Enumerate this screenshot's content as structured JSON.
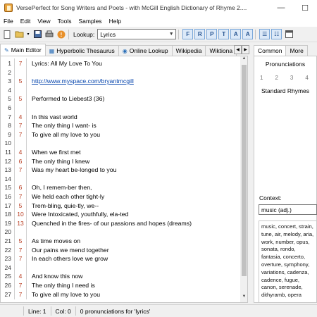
{
  "window": {
    "title": "VersePerfect for Song Writers and Poets - with McGill English Dictionary of Rhyme 2....",
    "minimize": "—",
    "maximize": "☐"
  },
  "menu": [
    "File",
    "Edit",
    "View",
    "Tools",
    "Samples",
    "Help"
  ],
  "toolbar": {
    "lookup_label": "Lookup:",
    "lookup_value": "Lyrics",
    "format_buttons": [
      "F",
      "R",
      "P",
      "T",
      "A",
      "A"
    ]
  },
  "tabs": [
    {
      "label": "Main Editor",
      "icon": "pencil-icon",
      "glyph": "✎"
    },
    {
      "label": "Hyperbolic Thesaurus",
      "icon": "thesaurus-icon",
      "glyph": "▦"
    },
    {
      "label": "Online Lookup",
      "icon": "globe-icon",
      "glyph": "◉"
    },
    {
      "label": "Wikipedia",
      "icon": "",
      "glyph": ""
    },
    {
      "label": "Wiktiona",
      "icon": "",
      "glyph": ""
    }
  ],
  "editor": {
    "lines": [
      {
        "n": "1",
        "s": "7",
        "text": "Lyrics: All My Love To You",
        "link": false
      },
      {
        "n": "2",
        "s": "",
        "text": "",
        "link": false
      },
      {
        "n": "3",
        "s": "5",
        "text": "http://www.myspace.com/bryantmcgill",
        "link": true
      },
      {
        "n": "4",
        "s": "",
        "text": "",
        "link": false
      },
      {
        "n": "5",
        "s": "5",
        "text": "Performed to Liebest3 (36)",
        "link": false
      },
      {
        "n": "6",
        "s": "",
        "text": "",
        "link": false
      },
      {
        "n": "7",
        "s": "4",
        "text": "In this vast world",
        "link": false
      },
      {
        "n": "8",
        "s": "7",
        "text": "The only thing I want- is",
        "link": false
      },
      {
        "n": "9",
        "s": "7",
        "text": "To give all my love to you",
        "link": false
      },
      {
        "n": "10",
        "s": "",
        "text": "",
        "link": false
      },
      {
        "n": "11",
        "s": "4",
        "text": "When we first met",
        "link": false
      },
      {
        "n": "12",
        "s": "6",
        "text": "The only thing I knew",
        "link": false
      },
      {
        "n": "13",
        "s": "7",
        "text": "Was my heart be-longed to you",
        "link": false
      },
      {
        "n": "14",
        "s": "",
        "text": "",
        "link": false
      },
      {
        "n": "15",
        "s": "6",
        "text": "Oh, I remem-ber then,",
        "link": false
      },
      {
        "n": "16",
        "s": "7",
        "text": "We held each other tight-ly",
        "link": false
      },
      {
        "n": "17",
        "s": "5",
        "text": "Trem-bling, quie-tly, we--",
        "link": false
      },
      {
        "n": "18",
        "s": "10",
        "text": "Were Intoxicated, youthfully, ela-ted",
        "link": false
      },
      {
        "n": "19",
        "s": "13",
        "text": "Quenched in the fires- of our passions and hopes (dreams)",
        "link": false
      },
      {
        "n": "20",
        "s": "",
        "text": "",
        "link": false
      },
      {
        "n": "21",
        "s": "5",
        "text": "As time moves on",
        "link": false
      },
      {
        "n": "22",
        "s": "7",
        "text": "Our pains we mend together",
        "link": false
      },
      {
        "n": "23",
        "s": "7",
        "text": "In each others love we grow",
        "link": false
      },
      {
        "n": "24",
        "s": "",
        "text": "",
        "link": false
      },
      {
        "n": "25",
        "s": "4",
        "text": "And know this now",
        "link": false
      },
      {
        "n": "26",
        "s": "7",
        "text": "The only thing I need is",
        "link": false
      },
      {
        "n": "27",
        "s": "7",
        "text": "To give all my love to you",
        "link": false
      }
    ]
  },
  "right_panel": {
    "tabs": [
      "Common",
      "More"
    ],
    "pronunciations_label": "Pronunciations",
    "syllables": [
      "1",
      "2",
      "3",
      "4"
    ],
    "standard_rhymes_label": "Standard Rhymes",
    "context_label": "Context:",
    "context_value": "music (adj.)",
    "synonyms": "music, concert, strain, tune, air, melody, aria, work, number, opus, sonata, rondo, fantasia, concerto, overture, symphony, variations, cadenza, cadence, fugue, canon, serenade, dithyramb, opera"
  },
  "status": {
    "line": "Line: 1",
    "col": "Col: 0",
    "message": "0 pronunciations for 'lyrics'"
  },
  "colors": {
    "accent": "#1f4e8c",
    "syllable": "#b83a1e",
    "link": "#0645ad"
  }
}
